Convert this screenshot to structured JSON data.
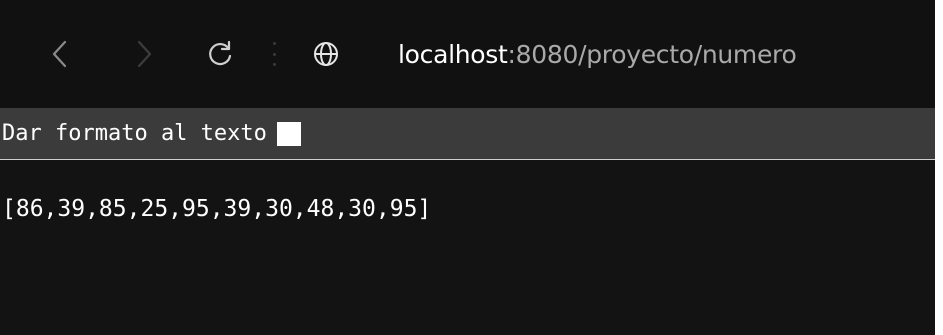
{
  "toolbar": {
    "back_icon": "chevron-left-icon",
    "forward_icon": "chevron-right-icon",
    "reload_icon": "reload-icon",
    "site_icon": "globe-icon",
    "url_host": "localhost",
    "url_rest": ":8080/proyecto/numero"
  },
  "format_bar": {
    "label": "Dar formato al texto",
    "checked": false
  },
  "content": {
    "json_text": "[86,39,85,25,95,39,30,48,30,95]"
  },
  "colors": {
    "background": "#131313",
    "format_bar": "#3b3b3b",
    "text": "#ffffff",
    "url_muted": "#a9a9a9"
  }
}
